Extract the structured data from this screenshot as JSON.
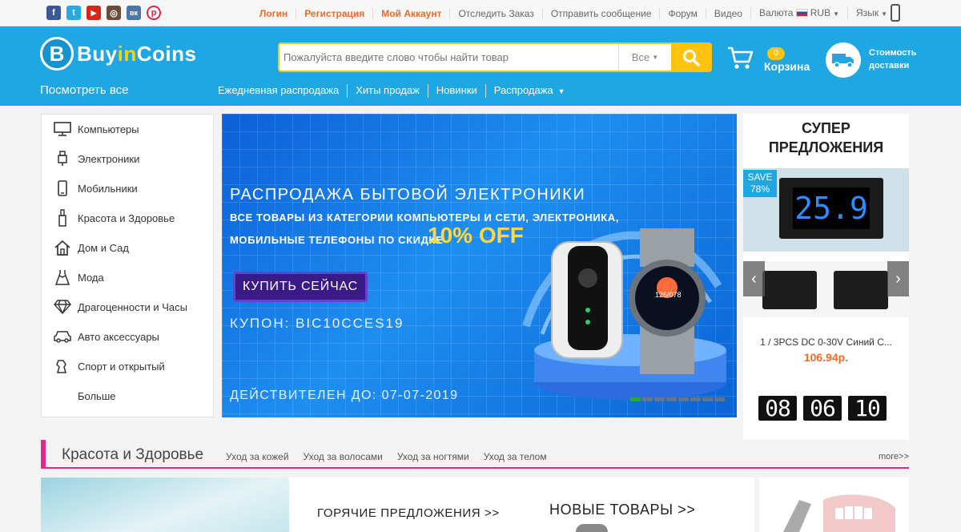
{
  "social_icons": [
    {
      "icon": "facebook-icon",
      "glyph": "f",
      "color": "#3b5998"
    },
    {
      "icon": "twitter-icon",
      "glyph": "t",
      "color": "#29a9e1"
    },
    {
      "icon": "youtube-icon",
      "glyph": "▶",
      "color": "#d8261c"
    },
    {
      "icon": "instagram-icon",
      "glyph": "◎",
      "color": "#6b4b3a"
    },
    {
      "icon": "vk-icon",
      "glyph": "вк",
      "color": "#4a76a8"
    },
    {
      "icon": "pinterest-icon",
      "glyph": "p",
      "color": "#e02640"
    }
  ],
  "topnav": {
    "login": "Логин",
    "register": "Регистрация",
    "account": "Мой Аккаунт",
    "track": "Отследить Заказ",
    "message": "Отправить сообщение",
    "forum": "Форум",
    "video": "Видео",
    "currency_label": "Валюта",
    "currency_value": "RUB",
    "language": "Язык"
  },
  "logo": {
    "mark": "B",
    "part1": "Buy",
    "part2": "in",
    "part3": "Coins"
  },
  "search": {
    "placeholder": "Пожалуйста введите слово чтобы найти товар",
    "category": "Все"
  },
  "cart": {
    "count": "0",
    "label": "Корзина"
  },
  "shipping": {
    "label": "Стоимость доставки"
  },
  "view_all": "Посмотреть все",
  "mainnav": {
    "daily": "Ежедневная распродажа",
    "hits": "Хиты продаж",
    "new": "Новинки",
    "sale": "Распродажа"
  },
  "categories": [
    {
      "label": "Компьютеры",
      "icon": "monitor-icon"
    },
    {
      "label": "Электроники",
      "icon": "usb-icon"
    },
    {
      "label": "Мобильники",
      "icon": "phone-icon"
    },
    {
      "label": "Красота и Здоровье",
      "icon": "lipstick-icon"
    },
    {
      "label": "Дом и Сад",
      "icon": "house-icon"
    },
    {
      "label": "Мода",
      "icon": "dress-icon"
    },
    {
      "label": "Драгоценности и Часы",
      "icon": "diamond-icon"
    },
    {
      "label": "Авто аксессуары",
      "icon": "car-icon"
    },
    {
      "label": "Спорт и открытый",
      "icon": "sport-icon"
    },
    {
      "label": "Больше",
      "icon": ""
    }
  ],
  "banner": {
    "title": "РАСПРОДАЖА БЫТОВОЙ ЭЛЕКТРОНИКИ",
    "sub1": "ВСЕ ТОВАРЫ ИЗ КАТЕГОРИИ КОМПЬЮТЕРЫ И СЕТИ, ЭЛЕКТРОНИКА,",
    "sub2": "МОБИЛЬНЫЕ ТЕЛЕФОНЫ ПО СКИДКЕ",
    "discount": "10% OFF",
    "button": "КУПИТЬ СЕЙЧАС",
    "coupon": "КУПОН: BIC10CCES19",
    "valid": "ДЕЙСТВИТЕЛЕН ДО: 07-07-2019",
    "watch_readout": "126/078",
    "slides_total": 8,
    "active_slide": 1
  },
  "super_offers": {
    "title_line1": "СУПЕР",
    "title_line2": "ПРЕДЛОЖЕНИЯ",
    "save_label": "SAVE",
    "save_value": "78%",
    "display_value": "25.9",
    "product_name": "1 / 3PCS DC 0-30V Синий С...",
    "price": "106.94р.",
    "timer": [
      "08",
      "06",
      "10"
    ]
  },
  "section": {
    "title": "Красота и Здоровье",
    "links": [
      "Уход за кожей",
      "Уход за волосами",
      "Уход за ногтями",
      "Уход за телом"
    ],
    "more": "more>>",
    "hot": "ГОРЯЧИЕ ПРЕДЛОЖЕНИЯ >>",
    "new": "НОВЫЕ ТОВАРЫ >>"
  }
}
